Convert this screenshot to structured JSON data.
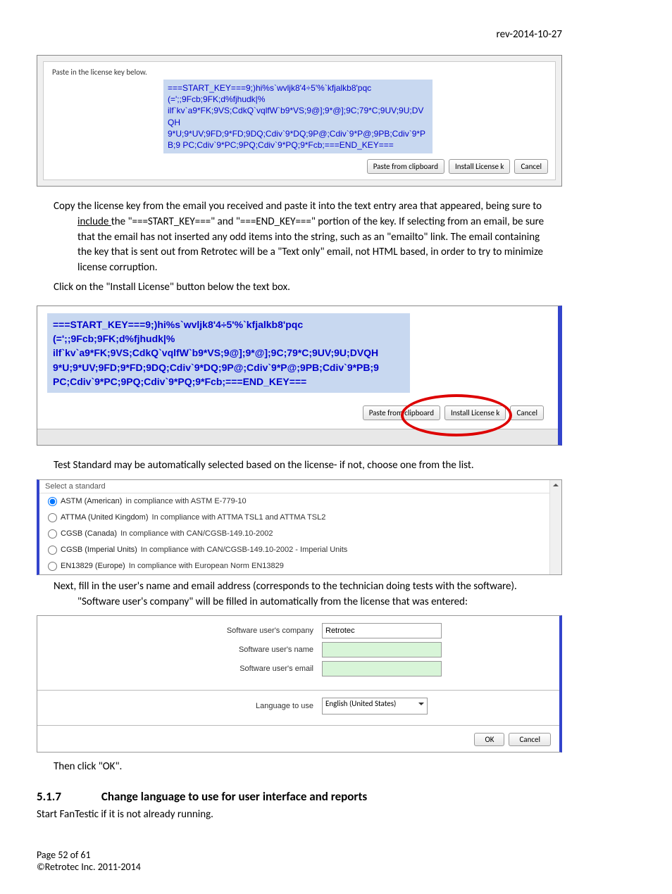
{
  "header": {
    "rev": "rev-2014-10-27"
  },
  "dialog1": {
    "instruction": "Paste in the license key below.",
    "license_text": "===START_KEY===9;)hi%s`wvljk8'4÷5'%`kfjalkb8'pqc (=';;9Fcb;9FK;d%fjhudk|% ilf`kv`a9*FK;9VS;CdkQ`vqlfW`b9*VS;9@];9*@];9C;79*C;9UV;9U;DVQH 9*U;9*UV;9FD;9*FD;9DQ;Cdiv`9*DQ;9P@;Cdiv`9*P@;9PB;Cdiv`9*PB;9 PC;Cdiv`9*PC;9PQ;Cdiv`9*PQ;9*Fcb;===END_KEY===",
    "buttons": {
      "paste": "Paste from clipboard",
      "install": "Install License k",
      "cancel": "Cancel"
    }
  },
  "instructions": {
    "p1a": "Copy the license key from the email you received and paste it into the text entry area that appeared, being sure to ",
    "p1_underline": "include ",
    "p1b": "the \"===START_KEY===\"  and \"===END_KEY===\" portion of the key.  If selecting from an email, be sure that the email has not inserted any odd items into the string, such as an \"emailto\" link.  The email containing the key that is sent out from Retrotec will be a \"Text only\" email, not HTML based, in order to try to minimize license corruption.",
    "p2": "Click on the \"Install License\" button below the text box."
  },
  "dialog2": {
    "license_text": "===START_KEY===9;)hi%s`wvljk8'4÷5'%`kfjalkb8'pqc (=';;9Fcb;9FK;d%fjhudk|% ilf`kv`a9*FK;9VS;CdkQ`vqlfW`b9*VS;9@];9*@];9C;79*C;9UV;9U;DVQH 9*U;9*UV;9FD;9*FD;9DQ;Cdiv`9*DQ;9P@;Cdiv`9*P@;9PB;Cdiv`9*PB;9 PC;Cdiv`9*PC;9PQ;Cdiv`9*PQ;9*Fcb;===END_KEY===",
    "buttons": {
      "paste": "Paste from clipboard",
      "install": "Install License k",
      "cancel": "Cancel"
    }
  },
  "p3": "Test Standard may be automatically selected based on the license- if not, choose one from the list.",
  "standards": {
    "header": "Select a standard",
    "options": [
      {
        "name": "ASTM (American)",
        "desc": "in compliance with ASTM E-779-10",
        "selected": true
      },
      {
        "name": "ATTMA (United Kingdom)",
        "desc": "In compliance with ATTMA TSL1 and ATTMA TSL2",
        "selected": false
      },
      {
        "name": "CGSB (Canada)",
        "desc": "In compliance with CAN/CGSB-149.10-2002",
        "selected": false
      },
      {
        "name": "CGSB (Imperial Units)",
        "desc": "In compliance with CAN/CGSB-149.10-2002 - Imperial Units",
        "selected": false
      },
      {
        "name": "EN13829 (Europe)",
        "desc": "In compliance with European Norm EN13829",
        "selected": false
      }
    ]
  },
  "p4": "Next, fill in the user's name and email address (corresponds to the technician doing tests with the software).  \"Software user's company\" will be filled in automatically from the license that was entered:",
  "userform": {
    "labels": {
      "company": "Software user's company",
      "name": "Software user's name",
      "email": "Software user's email",
      "lang": "Language to use"
    },
    "values": {
      "company": "Retrotec",
      "name": "",
      "email": "",
      "lang": "English (United States)"
    },
    "ok": "OK",
    "cancel": "Cancel"
  },
  "p5": "Then click \"OK\".",
  "heading": {
    "num": "5.1.7",
    "title": "Change language to use for user interface and reports"
  },
  "p6": "Start FanTestic if it is not already running.",
  "footer": {
    "page": "Page 52 of 61",
    "copy": "©Retrotec Inc. 2011-2014"
  }
}
